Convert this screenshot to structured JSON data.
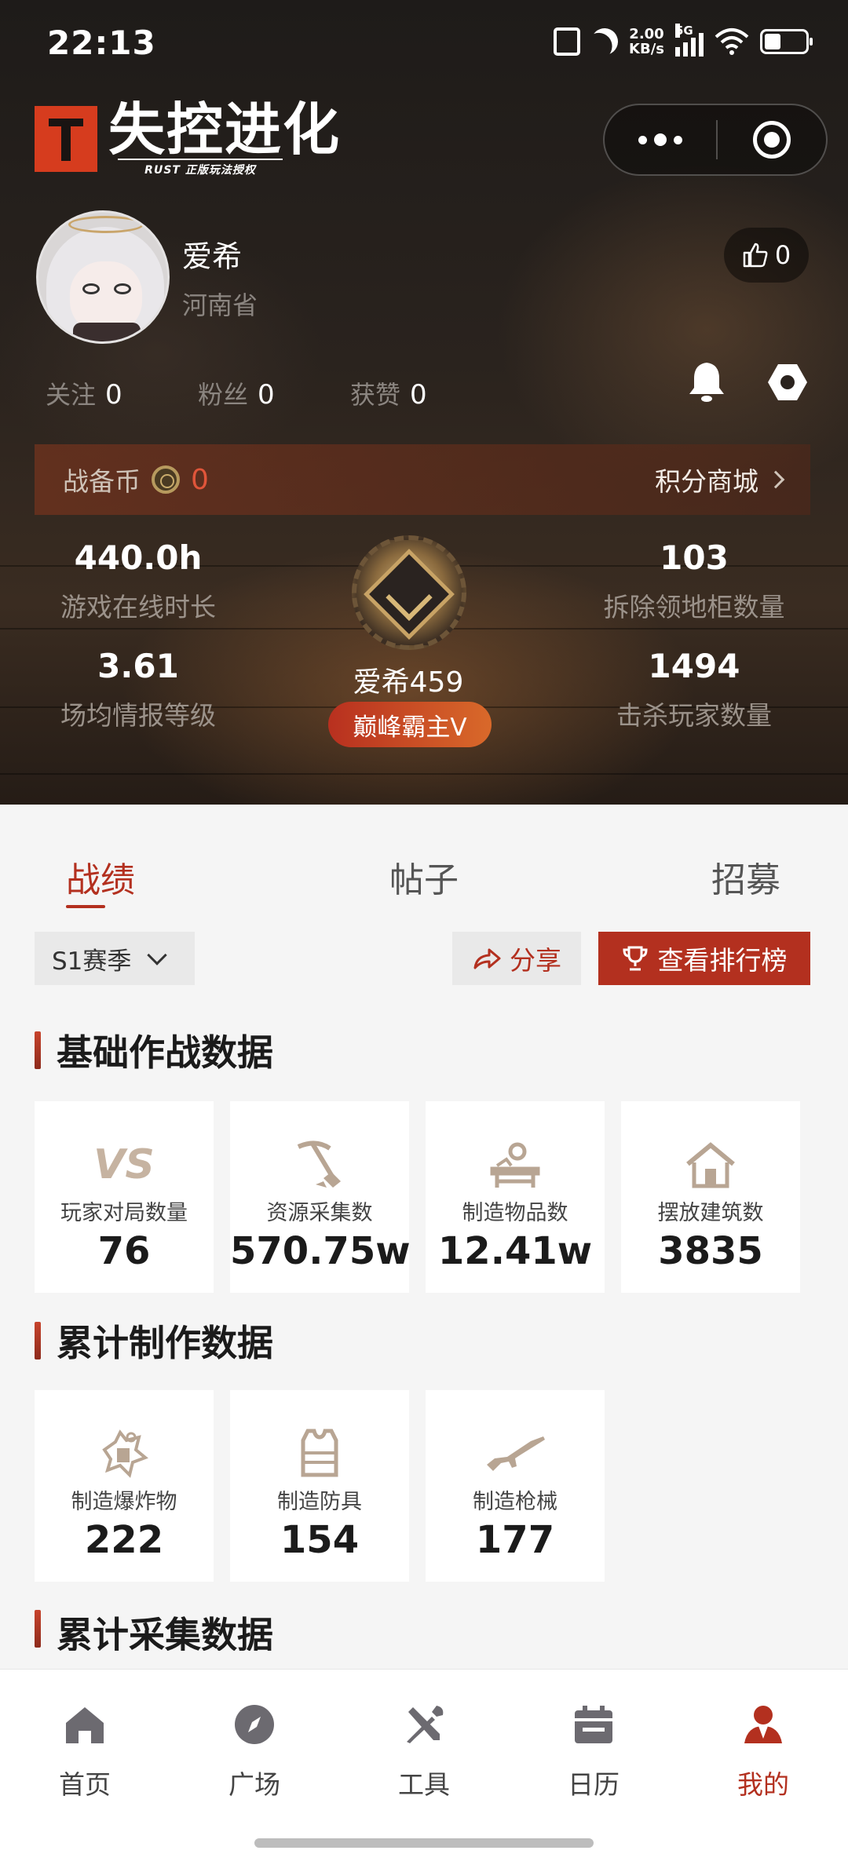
{
  "status_bar": {
    "time": "22:13",
    "net_speed_value": "2.00",
    "net_speed_unit": "KB/s",
    "network": "5G"
  },
  "header": {
    "logo_text": "失控进化",
    "logo_subtitle": "RUST 正版玩法授权"
  },
  "profile": {
    "name": "爱希",
    "region": "河南省",
    "likes": "0",
    "follow_label": "关注",
    "follow_count": "0",
    "fans_label": "粉丝",
    "fans_count": "0",
    "praised_label": "获赞",
    "praised_count": "0"
  },
  "coins": {
    "label": "战备币",
    "value": "0",
    "shop_label": "积分商城"
  },
  "metrics": {
    "online_hours": {
      "value": "440.0h",
      "label": "游戏在线时长"
    },
    "intel_level": {
      "value": "3.61",
      "label": "场均情报等级"
    },
    "demolished": {
      "value": "103",
      "label": "拆除领地柜数量"
    },
    "kills": {
      "value": "1494",
      "label": "击杀玩家数量"
    }
  },
  "rank": {
    "name": "爱希459",
    "tier": "巅峰霸主V"
  },
  "tabs": [
    "战绩",
    "帖子",
    "招募"
  ],
  "season": {
    "selected": "S1赛季"
  },
  "actions": {
    "share": "分享",
    "leaderboard": "查看排行榜"
  },
  "sections": {
    "basic": {
      "title": "基础作战数据",
      "cards": [
        {
          "icon": "vs-icon",
          "label": "玩家对局数量",
          "value": "76"
        },
        {
          "icon": "pickaxe-icon",
          "label": "资源采集数",
          "value": "570.75w"
        },
        {
          "icon": "workbench-icon",
          "label": "制造物品数",
          "value": "12.41w"
        },
        {
          "icon": "house-icon",
          "label": "摆放建筑数",
          "value": "3835"
        }
      ]
    },
    "crafting": {
      "title": "累计制作数据",
      "cards": [
        {
          "icon": "explosive-icon",
          "label": "制造爆炸物",
          "value": "222"
        },
        {
          "icon": "armor-icon",
          "label": "制造防具",
          "value": "154"
        },
        {
          "icon": "rifle-icon",
          "label": "制造枪械",
          "value": "177"
        }
      ]
    },
    "gathering": {
      "title": "累计采集数据"
    }
  },
  "bottom_nav": [
    {
      "icon": "home-icon",
      "label": "首页"
    },
    {
      "icon": "compass-icon",
      "label": "广场"
    },
    {
      "icon": "tools-icon",
      "label": "工具"
    },
    {
      "icon": "calendar-icon",
      "label": "日历"
    },
    {
      "icon": "profile-icon",
      "label": "我的",
      "active": true
    }
  ],
  "colors": {
    "accent": "#b3301f",
    "hero_bg": "#2a231e",
    "page_bg": "#f5f5f5",
    "icon_beige": "#b8a593"
  }
}
